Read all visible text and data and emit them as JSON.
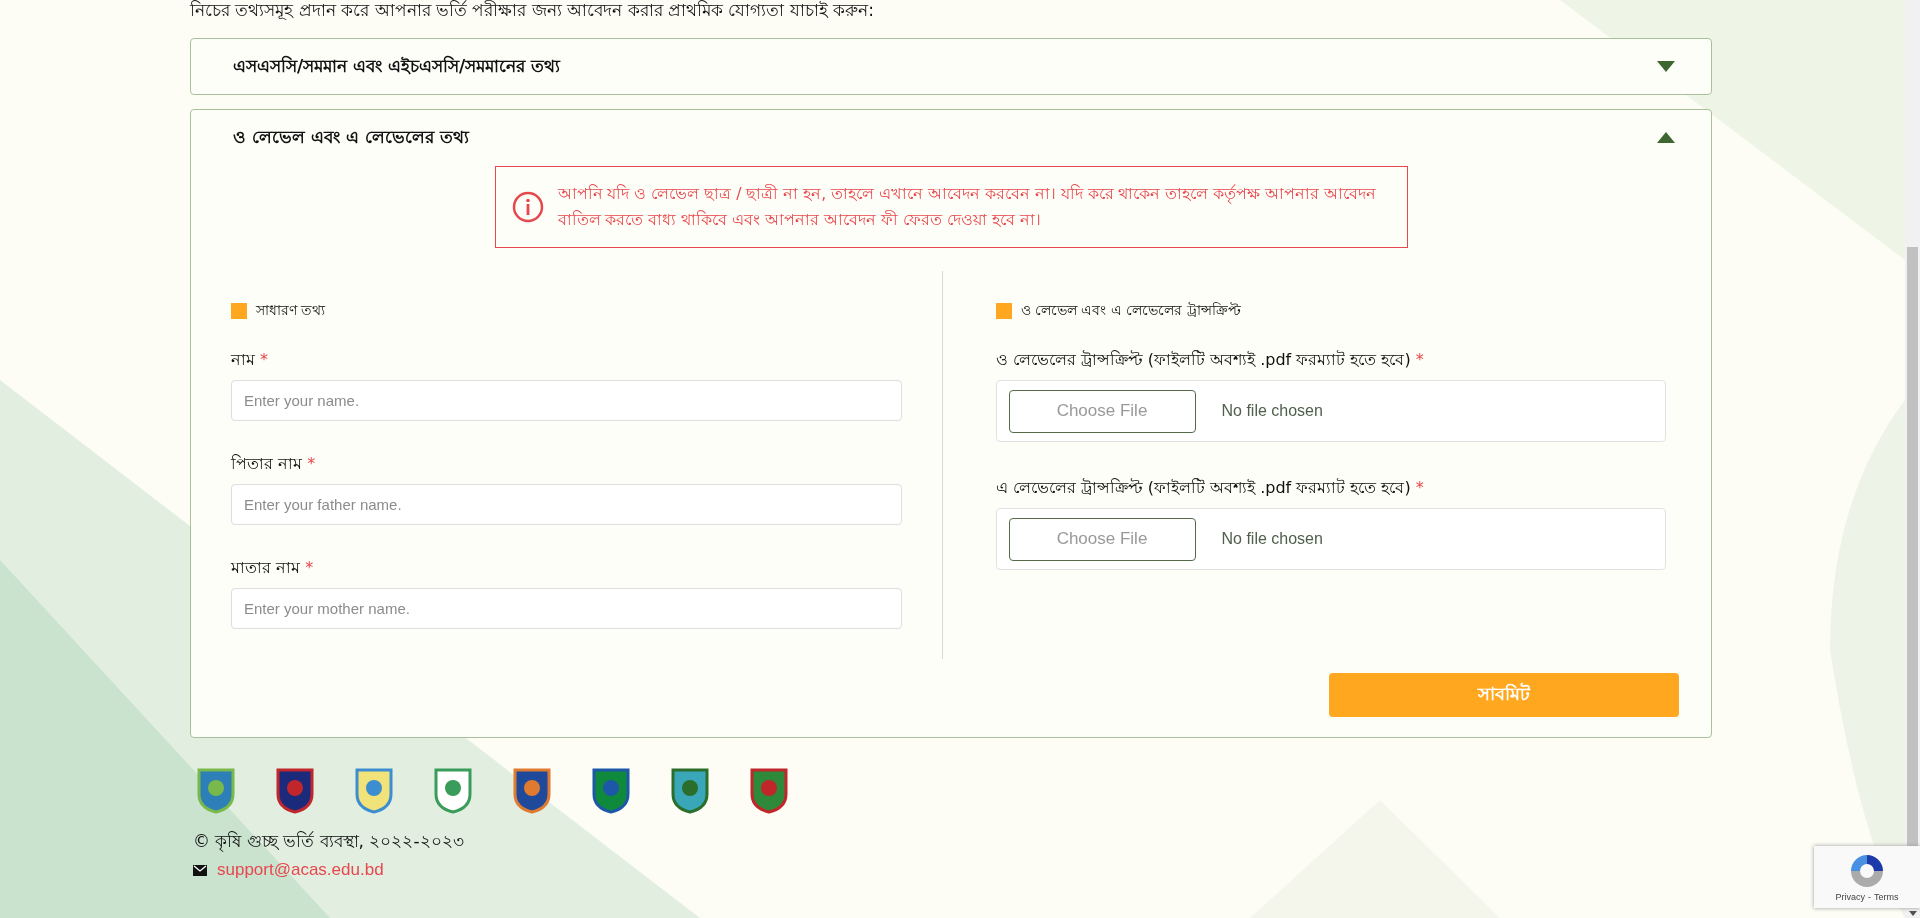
{
  "intro": "নিচের তথ্যসমূহ প্রদান করে আপনার ভর্তি পরীক্ষার জন্য আবেদন করার প্রাথমিক যোগ্যতা যাচাই করুন:",
  "accordions": [
    {
      "title": "এসএসসি/সমমান এবং এইচএসসি/সমমানের তথ্য",
      "expanded": false
    },
    {
      "title": "ও লেভেল এবং এ লেভেলের তথ্য",
      "expanded": true,
      "body": {
        "alert": "আপনি যদি ও লেভেল ছাত্র / ছাত্রী না হন, তাহলে এখানে আবেদন করবেন না। যদি করে থাকেন তাহলে কর্তৃপক্ষ আপনার আবেদন বাতিল করতে বাধ্য থাকিবে এবং আপনার আবেদন ফী ফেরত দেওয়া হবে না।",
        "general_section": {
          "title": "সাধারণ তথ্য",
          "fields": [
            {
              "label": "নাম",
              "required_mark": "*",
              "placeholder": "Enter your name."
            },
            {
              "label": "পিতার নাম",
              "required_mark": "*",
              "placeholder": "Enter your father name."
            },
            {
              "label": "মাতার নাম",
              "required_mark": "*",
              "placeholder": "Enter your mother name."
            }
          ]
        },
        "transcript_section": {
          "title": "ও লেভেল এবং এ লেভেলের ট্রান্সক্রিপ্ট",
          "files": [
            {
              "label": "ও লেভেলের ট্রান্সক্রিপ্ট (ফাইলটি অবশ্যই .pdf ফরম্যাট হতে হবে)",
              "required_mark": "*",
              "button": "Choose File",
              "status": "No file chosen"
            },
            {
              "label": "এ লেভেলের ট্রান্সক্রিপ্ট (ফাইলটি অবশ্যই .pdf ফরম্যাট হতে হবে)",
              "required_mark": "*",
              "button": "Choose File",
              "status": "No file chosen"
            }
          ]
        },
        "submit": "সাবমিট"
      }
    }
  ],
  "footer": {
    "copyright": "© কৃষি গুচ্ছ ভর্তি ব্যবস্থা, ২০২২-২০২৩",
    "email": "support@acas.edu.bd"
  },
  "recaptcha": {
    "links": [
      "Privacy",
      "Terms"
    ],
    "separator": "-"
  }
}
